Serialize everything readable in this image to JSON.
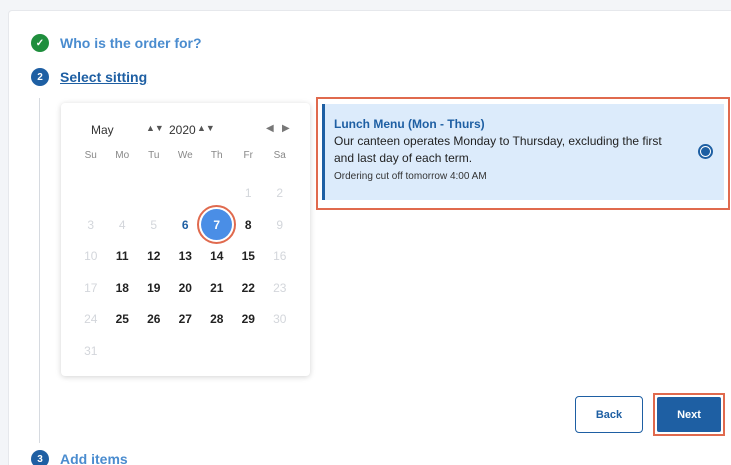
{
  "steps": {
    "step1": {
      "number": "✓",
      "title": "Who is the order for?"
    },
    "step2": {
      "number": "2",
      "title": "Select sitting"
    },
    "step3": {
      "number": "3",
      "title": "Add items"
    }
  },
  "calendar": {
    "month": "May",
    "year": "2020",
    "dow": [
      "Su",
      "Mo",
      "Tu",
      "We",
      "Th",
      "Fr",
      "Sa"
    ],
    "weeks": [
      [
        {
          "d": ""
        },
        {
          "d": ""
        },
        {
          "d": ""
        },
        {
          "d": ""
        },
        {
          "d": ""
        },
        {
          "d": "1",
          "state": "muted"
        },
        {
          "d": "2",
          "state": "muted"
        }
      ],
      [
        {
          "d": "3",
          "state": "muted"
        },
        {
          "d": "4",
          "state": "muted"
        },
        {
          "d": "5",
          "state": "muted"
        },
        {
          "d": "6",
          "state": "today"
        },
        {
          "d": "7",
          "state": "selected"
        },
        {
          "d": "8"
        },
        {
          "d": "9",
          "state": "muted"
        }
      ],
      [
        {
          "d": "10",
          "state": "muted"
        },
        {
          "d": "11"
        },
        {
          "d": "12"
        },
        {
          "d": "13"
        },
        {
          "d": "14"
        },
        {
          "d": "15"
        },
        {
          "d": "16",
          "state": "muted"
        }
      ],
      [
        {
          "d": "17",
          "state": "muted"
        },
        {
          "d": "18"
        },
        {
          "d": "19"
        },
        {
          "d": "20"
        },
        {
          "d": "21"
        },
        {
          "d": "22"
        },
        {
          "d": "23",
          "state": "muted"
        }
      ],
      [
        {
          "d": "24",
          "state": "muted"
        },
        {
          "d": "25"
        },
        {
          "d": "26"
        },
        {
          "d": "27"
        },
        {
          "d": "28"
        },
        {
          "d": "29"
        },
        {
          "d": "30",
          "state": "muted"
        }
      ],
      [
        {
          "d": "31",
          "state": "muted"
        },
        {
          "d": ""
        },
        {
          "d": ""
        },
        {
          "d": ""
        },
        {
          "d": ""
        },
        {
          "d": ""
        },
        {
          "d": ""
        }
      ]
    ]
  },
  "menu": {
    "title": "Lunch Menu (Mon - Thurs)",
    "description": "Our canteen operates Monday to Thursday, excluding the first and last day of each term.",
    "cutoff": "Ordering cut off tomorrow 4:00 AM",
    "selected": true
  },
  "buttons": {
    "back": "Back",
    "next": "Next"
  },
  "colors": {
    "primary": "#1e5fa3",
    "done": "#1f8e3d",
    "highlight": "#e06a4e",
    "selected_day": "#4a8ee6"
  }
}
